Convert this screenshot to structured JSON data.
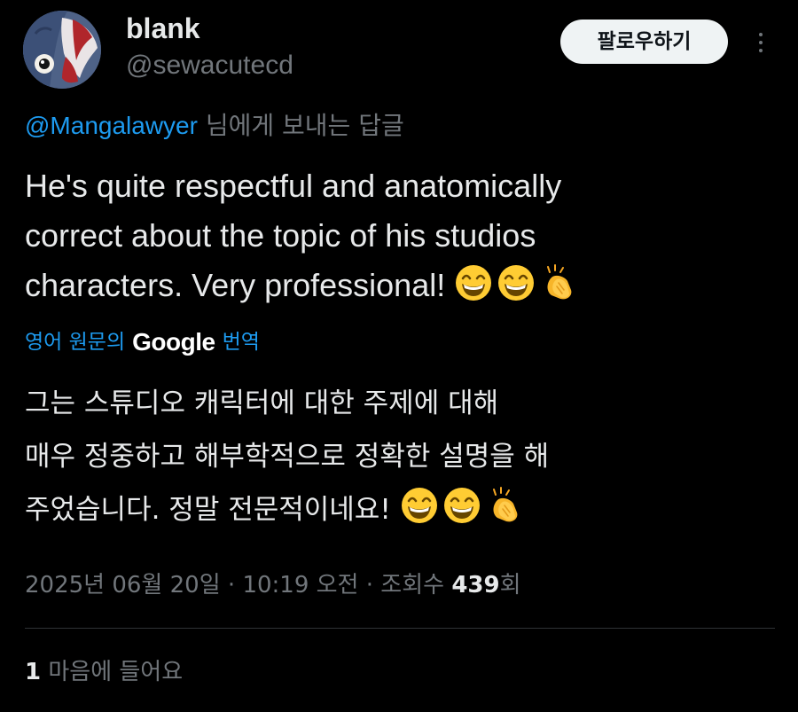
{
  "author": {
    "display_name": "blank",
    "handle": "@sewacutecd"
  },
  "header": {
    "follow_label": "팔로우하기",
    "more_icon": "more-vertical-icon"
  },
  "reply": {
    "mention": "@Mangalawyer",
    "suffix": "님에게 보내는 답글"
  },
  "tweet": {
    "lines": [
      "He's quite respectful and anatomically",
      "correct about the topic of his studios",
      "characters. Very professional!"
    ],
    "emojis": [
      "grinning-face-with-smiling-eyes-emoji",
      "grinning-face-with-smiling-eyes-emoji",
      "clapping-hands-emoji"
    ]
  },
  "translation": {
    "prefix": "영어 원문의",
    "provider": "Google",
    "link": "번역",
    "lines": [
      "그는 스튜디오 캐릭터에 대한 주제에 대해",
      "매우 정중하고 해부학적으로 정확한 설명을 해",
      "주었습니다. 정말 전문적이네요!"
    ]
  },
  "meta": {
    "date": "2025년 06월 20일",
    "separator": "·",
    "time": "10:19 오전",
    "views_label": "조회수",
    "views_count": "439",
    "views_unit": "회"
  },
  "likes": {
    "count": "1",
    "label": "마음에 들어요"
  },
  "colors": {
    "background": "#000000",
    "text": "#e7e9ea",
    "secondary": "#71767b",
    "link": "#1d9bf0",
    "follow_bg": "#eff3f4",
    "divider": "#2f3336"
  }
}
